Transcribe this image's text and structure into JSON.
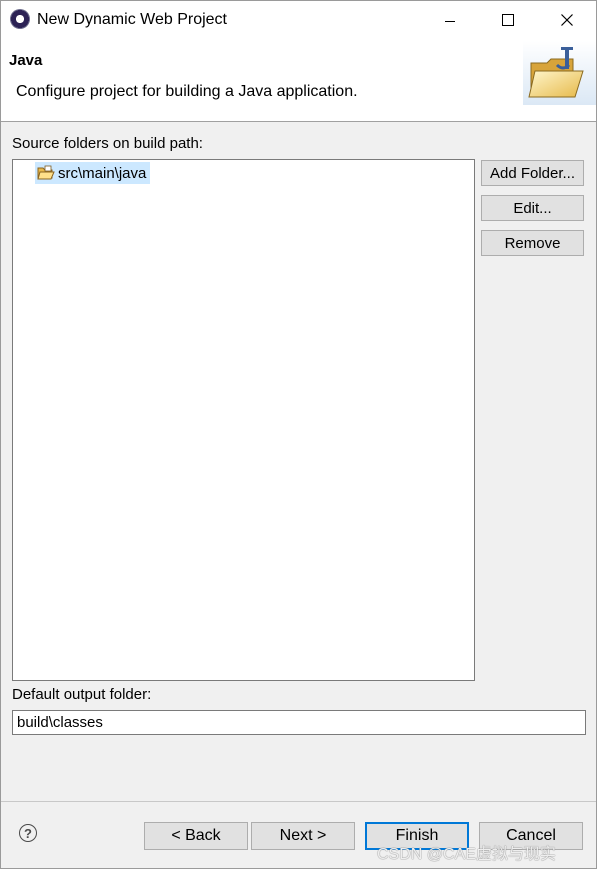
{
  "window": {
    "title": "New Dynamic Web Project",
    "app_icon": "eclipse-icon"
  },
  "header": {
    "title": "Java",
    "description": "Configure project for building a Java application.",
    "banner_icon": "java-folder-icon"
  },
  "source": {
    "label": "Source folders on build path:",
    "folders": [
      {
        "label": "src\\main\\java",
        "icon": "source-folder-icon",
        "selected": true
      }
    ],
    "buttons": {
      "add": "Add Folder...",
      "edit": "Edit...",
      "remove": "Remove"
    }
  },
  "output": {
    "label": "Default output folder:",
    "value": "build\\classes"
  },
  "footer": {
    "help_icon": "?",
    "back": "< Back",
    "next": "Next >",
    "finish": "Finish",
    "cancel": "Cancel"
  },
  "watermark": "CSDN @CAE虚拟与现实",
  "colors": {
    "selection": "#cce8ff",
    "default_button_border": "#0078d7"
  }
}
